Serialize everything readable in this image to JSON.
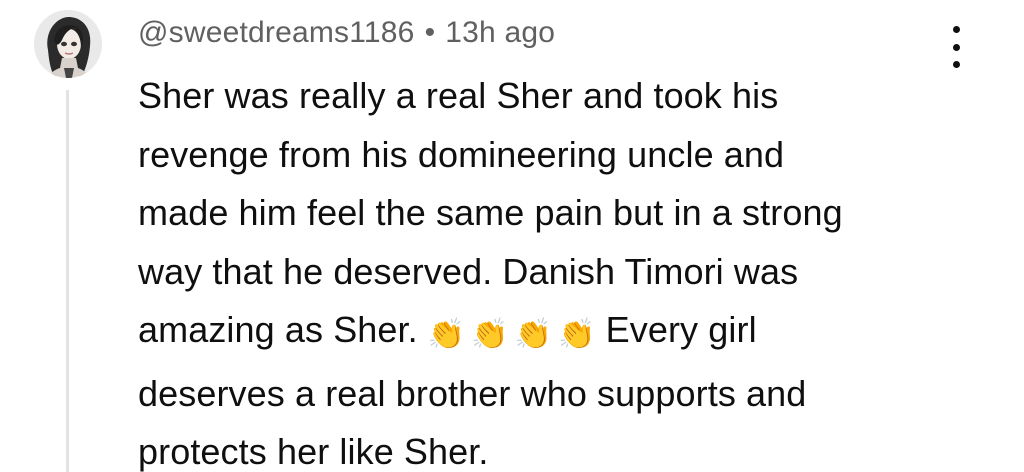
{
  "comment": {
    "username": "@sweetdreams1186",
    "separator": "•",
    "timestamp": "13h ago",
    "lines": [
      "Sher was really a real Sher and took his",
      "revenge from his domineering uncle and",
      "made him feel the same pain but in a strong",
      "way that he deserved. Danish Timori was",
      "amazing as Sher.",
      "Every girl",
      "deserves a real brother who supports and",
      "protects her like Sher."
    ],
    "emoji": {
      "name": "clapping-hands",
      "glyph": "👏",
      "count": 4
    },
    "avatar_icon": "girl-avatar-icon",
    "menu_icon": "more-vertical-icon"
  }
}
